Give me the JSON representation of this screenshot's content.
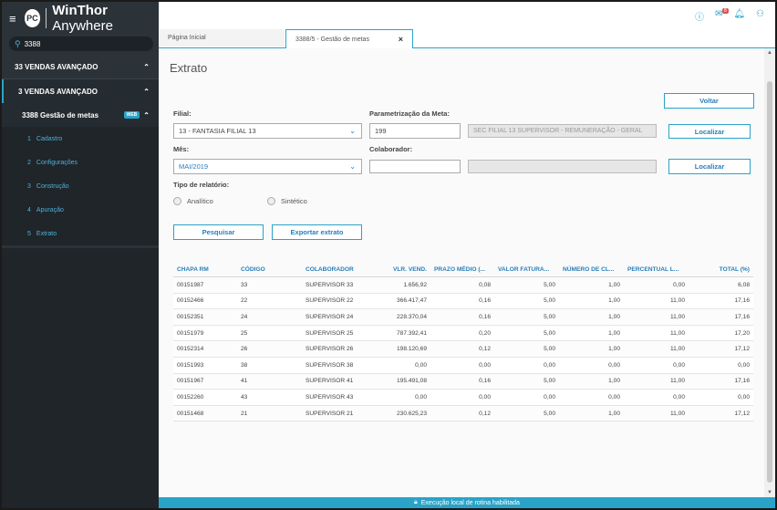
{
  "app": {
    "logo_short": "PC",
    "name_bold": "WinThor",
    "name_rest": " Anywhere"
  },
  "sidebar": {
    "search_value": "3388",
    "menu": [
      {
        "label": "33  VENDAS AVANÇADO"
      },
      {
        "label": "3  VENDAS AVANÇADO"
      },
      {
        "label": "3388  Gestão de metas",
        "badge": "WEB"
      }
    ],
    "subitems": [
      {
        "num": "1",
        "label": "Cadastro"
      },
      {
        "num": "2",
        "label": "Configurações"
      },
      {
        "num": "3",
        "label": "Construção"
      },
      {
        "num": "4",
        "label": "Apuração"
      },
      {
        "num": "5",
        "label": "Extrato"
      }
    ]
  },
  "header": {
    "mail_count": "8"
  },
  "tabs": {
    "home": "Página Inicial",
    "active": "3388/5 - Gestão de metas"
  },
  "page": {
    "title": "Extrato",
    "back_button": "Voltar",
    "filial_label": "Filial:",
    "filial_value": "13 - FANTASIA FILIAL 13",
    "param_label": "Parametrização da Meta:",
    "param_code": "199",
    "param_desc": "SEC FILIAL 13 SUPERVISOR - REMUNERAÇÃO - GERAL",
    "localizar1": "Localizar",
    "mes_label": "Mês:",
    "mes_value": "MAI/2019",
    "colab_label": "Colaborador:",
    "colab_code": "",
    "colab_desc": "",
    "localizar2": "Localizar",
    "tipo_label": "Tipo de relatório:",
    "radio_analitico": "Analítico",
    "radio_sintetico": "Sintético",
    "pesquisar": "Pesquisar",
    "exportar": "Exportar extrato"
  },
  "table": {
    "headers": [
      "CHAPA RM",
      "CÓDIGO",
      "COLABORADOR",
      "VLR. VEND.",
      "PRAZO MÉDIO (...",
      "VALOR FATURA...",
      "NÚMERO DE CL...",
      "PERCENTUAL L...",
      "TOTAL (%)"
    ],
    "rows": [
      [
        "00151987",
        "33",
        "SUPERVISOR 33",
        "1.656,92",
        "0,08",
        "5,00",
        "1,00",
        "0,00",
        "6,08"
      ],
      [
        "00152466",
        "22",
        "SUPERVISOR 22",
        "366.417,47",
        "0,16",
        "5,00",
        "1,00",
        "11,00",
        "17,16"
      ],
      [
        "00152351",
        "24",
        "SUPERVISOR 24",
        "228.370,04",
        "0,16",
        "5,00",
        "1,00",
        "11,00",
        "17,16"
      ],
      [
        "00151979",
        "25",
        "SUPERVISOR 25",
        "787.392,41",
        "0,20",
        "5,00",
        "1,00",
        "11,00",
        "17,20"
      ],
      [
        "00152314",
        "26",
        "SUPERVISOR 26",
        "198.120,69",
        "0,12",
        "5,00",
        "1,00",
        "11,00",
        "17,12"
      ],
      [
        "00151993",
        "38",
        "SUPERVISOR 38",
        "0,00",
        "0,00",
        "0,00",
        "0,00",
        "0,00",
        "0,00"
      ],
      [
        "00151967",
        "41",
        "SUPERVISOR 41",
        "195.491,08",
        "0,16",
        "5,00",
        "1,00",
        "11,00",
        "17,16"
      ],
      [
        "00152260",
        "43",
        "SUPERVISOR 43",
        "0,00",
        "0,00",
        "0,00",
        "0,00",
        "0,00",
        "0,00"
      ],
      [
        "00151468",
        "21",
        "SUPERVISOR 21",
        "230.625,23",
        "0,12",
        "5,00",
        "1,00",
        "11,00",
        "17,12"
      ]
    ]
  },
  "footer": {
    "text": "Execução local de rotina habilitada"
  },
  "colors": {
    "accent": "#2aa3c9",
    "sidebar": "#2b3238"
  }
}
